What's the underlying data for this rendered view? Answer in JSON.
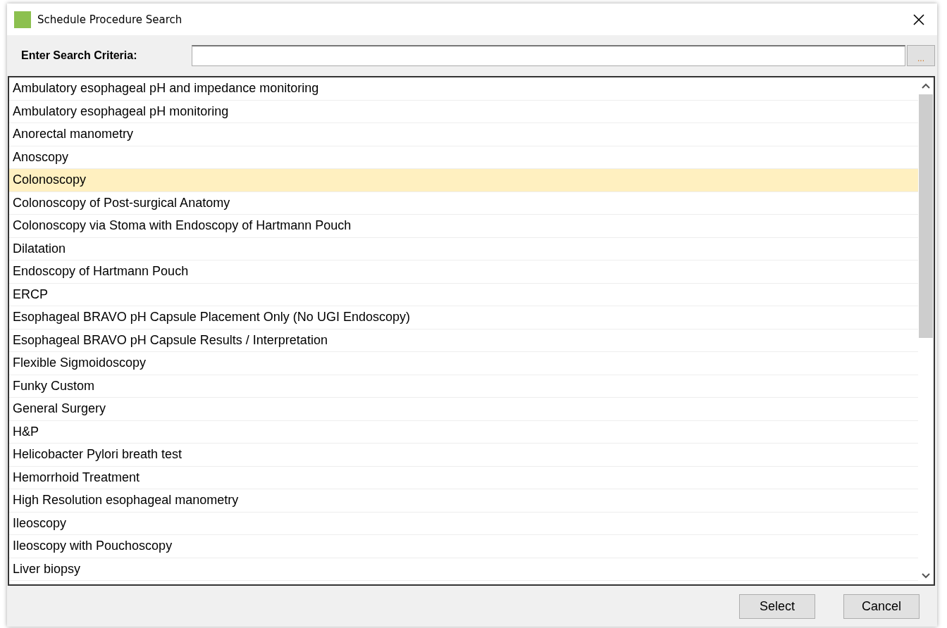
{
  "window": {
    "title": "Schedule Procedure Search"
  },
  "search": {
    "label": "Enter Search Criteria:",
    "browse_button": "..."
  },
  "procedures": [
    {
      "name": "Ambulatory esophageal pH and impedance monitoring",
      "selected": false
    },
    {
      "name": "Ambulatory esophageal pH monitoring",
      "selected": false
    },
    {
      "name": "Anorectal manometry",
      "selected": false
    },
    {
      "name": "Anoscopy",
      "selected": false
    },
    {
      "name": "Colonoscopy",
      "selected": true
    },
    {
      "name": "Colonoscopy of Post-surgical Anatomy",
      "selected": false
    },
    {
      "name": "Colonoscopy via Stoma with Endoscopy of Hartmann Pouch",
      "selected": false
    },
    {
      "name": "Dilatation",
      "selected": false
    },
    {
      "name": "Endoscopy of Hartmann Pouch",
      "selected": false
    },
    {
      "name": "ERCP",
      "selected": false
    },
    {
      "name": "Esophageal BRAVO pH Capsule Placement Only (No UGI Endoscopy)",
      "selected": false
    },
    {
      "name": "Esophageal BRAVO pH Capsule Results / Interpretation",
      "selected": false
    },
    {
      "name": "Flexible Sigmoidoscopy",
      "selected": false
    },
    {
      "name": "Funky Custom",
      "selected": false
    },
    {
      "name": "General Surgery",
      "selected": false
    },
    {
      "name": "H&P",
      "selected": false
    },
    {
      "name": "Helicobacter Pylori breath test",
      "selected": false
    },
    {
      "name": "Hemorrhoid Treatment",
      "selected": false
    },
    {
      "name": "High Resolution esophageal manometry",
      "selected": false
    },
    {
      "name": "Ileoscopy",
      "selected": false
    },
    {
      "name": "Ileoscopy with Pouchoscopy",
      "selected": false
    },
    {
      "name": "Liver biopsy",
      "selected": false
    }
  ],
  "buttons": [
    "Select",
    "Cancel"
  ]
}
